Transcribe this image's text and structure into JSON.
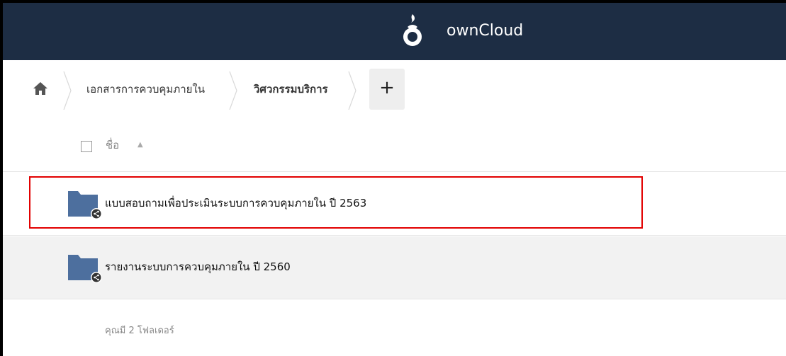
{
  "header": {
    "brand": "ownCloud",
    "logo_icon": "owncloud-logo-icon",
    "background": "#1d2d44"
  },
  "breadcrumb": {
    "home_icon": "home-icon",
    "items": [
      {
        "label": "เอกสารการควบคุมภายใน"
      },
      {
        "label": "วิศวกรรมบริการ"
      }
    ],
    "add_label": "+"
  },
  "table": {
    "name_header": "ชื่อ",
    "sort_indicator": "▲",
    "rows": [
      {
        "name": "แบบสอบถามเพื่อประเมินระบบการควบคุมภายใน ปี 2563",
        "type": "shared-folder",
        "highlighted": true
      },
      {
        "name": "รายงานระบบการควบคุมภายใน ปี 2560",
        "type": "shared-folder",
        "highlighted": false
      }
    ],
    "summary": "คุณมี 2 โฟลเดอร์"
  },
  "colors": {
    "folder": "#4d6f9e",
    "highlight_box": "#e20000",
    "row_alt": "#f2f2f2"
  }
}
